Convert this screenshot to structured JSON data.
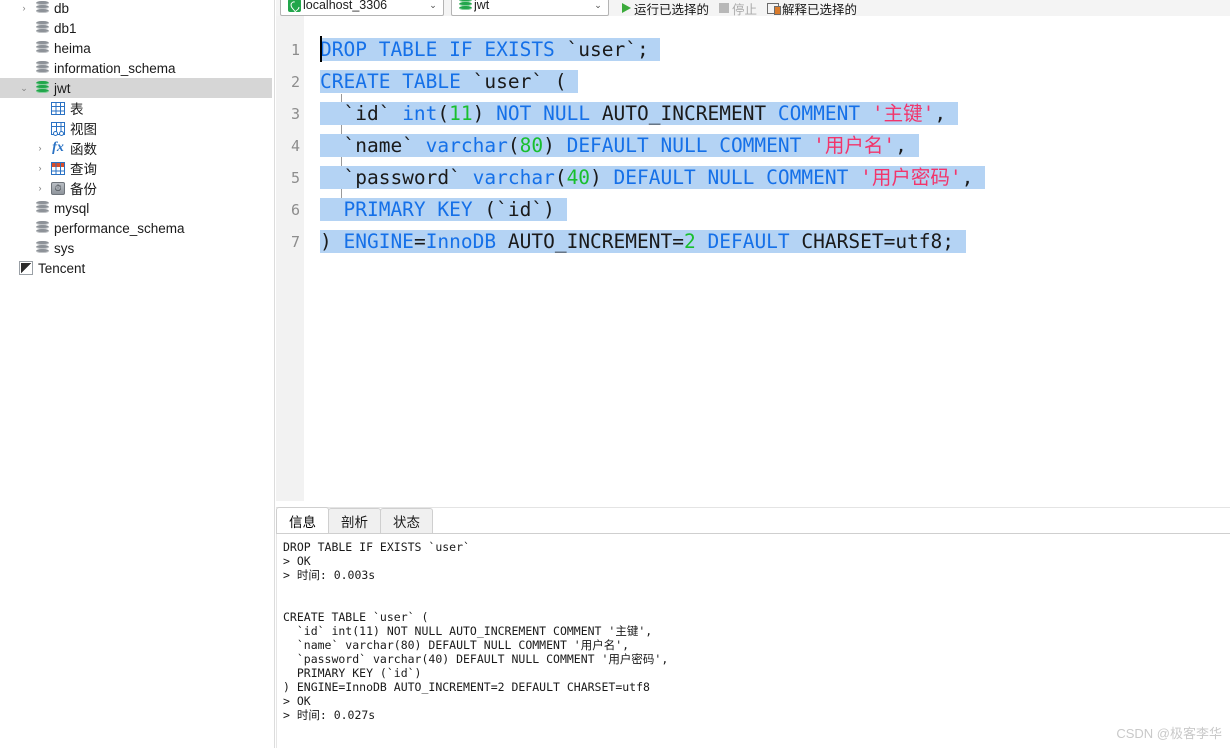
{
  "toolbar": {
    "connection": {
      "icon": "connection-icon",
      "value": "localhost_3306",
      "arrow": "⌄"
    },
    "database": {
      "icon": "database-icon",
      "value": "jwt",
      "arrow": "⌄"
    },
    "run_label": "运行已选择的",
    "stop_label": "停止",
    "explain_label": "解释已选择的"
  },
  "sidebar": {
    "items": [
      {
        "label": "db",
        "icon": "database-icon",
        "indent": 1,
        "twisty": "›",
        "selected": false
      },
      {
        "label": "db1",
        "icon": "database-icon",
        "indent": 1,
        "twisty": "",
        "selected": false
      },
      {
        "label": "heima",
        "icon": "database-icon",
        "indent": 1,
        "twisty": "",
        "selected": false
      },
      {
        "label": "information_schema",
        "icon": "database-icon",
        "indent": 1,
        "twisty": "",
        "selected": false
      },
      {
        "label": "jwt",
        "icon": "database-icon-green",
        "indent": 1,
        "twisty": "⌄",
        "selected": true
      },
      {
        "label": "表",
        "icon": "table-icon",
        "indent": 2,
        "twisty": "",
        "selected": false
      },
      {
        "label": "视图",
        "icon": "view-icon",
        "indent": 2,
        "twisty": "",
        "selected": false
      },
      {
        "label": "函数",
        "icon": "function-icon",
        "indent": 2,
        "twisty": "›",
        "selected": false
      },
      {
        "label": "查询",
        "icon": "query-icon",
        "indent": 2,
        "twisty": "›",
        "selected": false
      },
      {
        "label": "备份",
        "icon": "backup-icon",
        "indent": 2,
        "twisty": "›",
        "selected": false
      },
      {
        "label": "mysql",
        "icon": "database-icon",
        "indent": 1,
        "twisty": "",
        "selected": false
      },
      {
        "label": "performance_schema",
        "icon": "database-icon",
        "indent": 1,
        "twisty": "",
        "selected": false
      },
      {
        "label": "sys",
        "icon": "database-icon",
        "indent": 1,
        "twisty": "",
        "selected": false
      },
      {
        "label": "Tencent",
        "icon": "tencent-icon",
        "indent": 0,
        "twisty": "",
        "selected": false
      }
    ]
  },
  "editor": {
    "line_numbers": [
      "1",
      "2",
      "3",
      "4",
      "5",
      "6",
      "7"
    ],
    "lines": [
      {
        "n": 1,
        "text": "DROP TABLE IF EXISTS `user`;"
      },
      {
        "n": 2,
        "text": "CREATE TABLE `user` ("
      },
      {
        "n": 3,
        "text": "  `id` int(11) NOT NULL AUTO_INCREMENT COMMENT '主键',"
      },
      {
        "n": 4,
        "text": "  `name` varchar(80) DEFAULT NULL COMMENT '用户名',"
      },
      {
        "n": 5,
        "text": "  `password` varchar(40) DEFAULT NULL COMMENT '用户密码',"
      },
      {
        "n": 6,
        "text": "  PRIMARY KEY (`id`)"
      },
      {
        "n": 7,
        "text": ") ENGINE=InnoDB AUTO_INCREMENT=2 DEFAULT CHARSET=utf8;"
      }
    ],
    "tokens": {
      "l1": [
        {
          "t": "DROP TABLE IF EXISTS ",
          "c": "kw"
        },
        {
          "t": "`user`;",
          "c": "pl"
        }
      ],
      "l2": [
        {
          "t": "CREATE TABLE ",
          "c": "kw"
        },
        {
          "t": "`user` (",
          "c": "pl"
        }
      ],
      "l3": [
        {
          "t": "  `id` ",
          "c": "pl"
        },
        {
          "t": "int",
          "c": "kw"
        },
        {
          "t": "(",
          "c": "pl"
        },
        {
          "t": "11",
          "c": "num"
        },
        {
          "t": ") ",
          "c": "pl"
        },
        {
          "t": "NOT NULL ",
          "c": "kw"
        },
        {
          "t": "AUTO_INCREMENT ",
          "c": "pl"
        },
        {
          "t": "COMMENT ",
          "c": "kw"
        },
        {
          "t": "'主键'",
          "c": "str"
        },
        {
          "t": ",",
          "c": "pl"
        }
      ],
      "l4": [
        {
          "t": "  `name` ",
          "c": "pl"
        },
        {
          "t": "varchar",
          "c": "kw"
        },
        {
          "t": "(",
          "c": "pl"
        },
        {
          "t": "80",
          "c": "num"
        },
        {
          "t": ") ",
          "c": "pl"
        },
        {
          "t": "DEFAULT NULL ",
          "c": "kw"
        },
        {
          "t": "COMMENT ",
          "c": "kw"
        },
        {
          "t": "'用户名'",
          "c": "str"
        },
        {
          "t": ",",
          "c": "pl"
        }
      ],
      "l5": [
        {
          "t": "  `password` ",
          "c": "pl"
        },
        {
          "t": "varchar",
          "c": "kw"
        },
        {
          "t": "(",
          "c": "pl"
        },
        {
          "t": "40",
          "c": "num"
        },
        {
          "t": ") ",
          "c": "pl"
        },
        {
          "t": "DEFAULT NULL ",
          "c": "kw"
        },
        {
          "t": "COMMENT ",
          "c": "kw"
        },
        {
          "t": "'用户密码'",
          "c": "str"
        },
        {
          "t": ",",
          "c": "pl"
        }
      ],
      "l6": [
        {
          "t": "  ",
          "c": "pl"
        },
        {
          "t": "PRIMARY KEY ",
          "c": "kw"
        },
        {
          "t": "(`id`)",
          "c": "pl"
        }
      ],
      "l7": [
        {
          "t": ") ",
          "c": "pl"
        },
        {
          "t": "ENGINE",
          "c": "kw"
        },
        {
          "t": "=",
          "c": "pl"
        },
        {
          "t": "InnoDB",
          "c": "kw"
        },
        {
          "t": " AUTO_INCREMENT=",
          "c": "pl"
        },
        {
          "t": "2",
          "c": "num"
        },
        {
          "t": " ",
          "c": "pl"
        },
        {
          "t": "DEFAULT",
          "c": "kw"
        },
        {
          "t": " CHARSET=utf8;",
          "c": "pl"
        }
      ]
    }
  },
  "bottom_panel": {
    "tabs": [
      {
        "label": "信息",
        "active": true
      },
      {
        "label": "剖析",
        "active": false
      },
      {
        "label": "状态",
        "active": false
      }
    ],
    "log": [
      "DROP TABLE IF EXISTS `user`",
      "> OK",
      "> 时间: 0.003s",
      "",
      "",
      "CREATE TABLE `user` (",
      "  `id` int(11) NOT NULL AUTO_INCREMENT COMMENT '主键',",
      "  `name` varchar(80) DEFAULT NULL COMMENT '用户名',",
      "  `password` varchar(40) DEFAULT NULL COMMENT '用户密码',",
      "  PRIMARY KEY (`id`)",
      ") ENGINE=InnoDB AUTO_INCREMENT=2 DEFAULT CHARSET=utf8",
      "> OK",
      "> 时间: 0.027s"
    ]
  },
  "watermark": {
    "text": "CSDN @极客李华"
  },
  "colors": {
    "keyword": "#1570e8",
    "number": "#18bf2e",
    "string": "#f2356b",
    "selection": "#b4d3f4",
    "selected_row": "#d6d6d6",
    "accent_green": "#22a64b"
  }
}
